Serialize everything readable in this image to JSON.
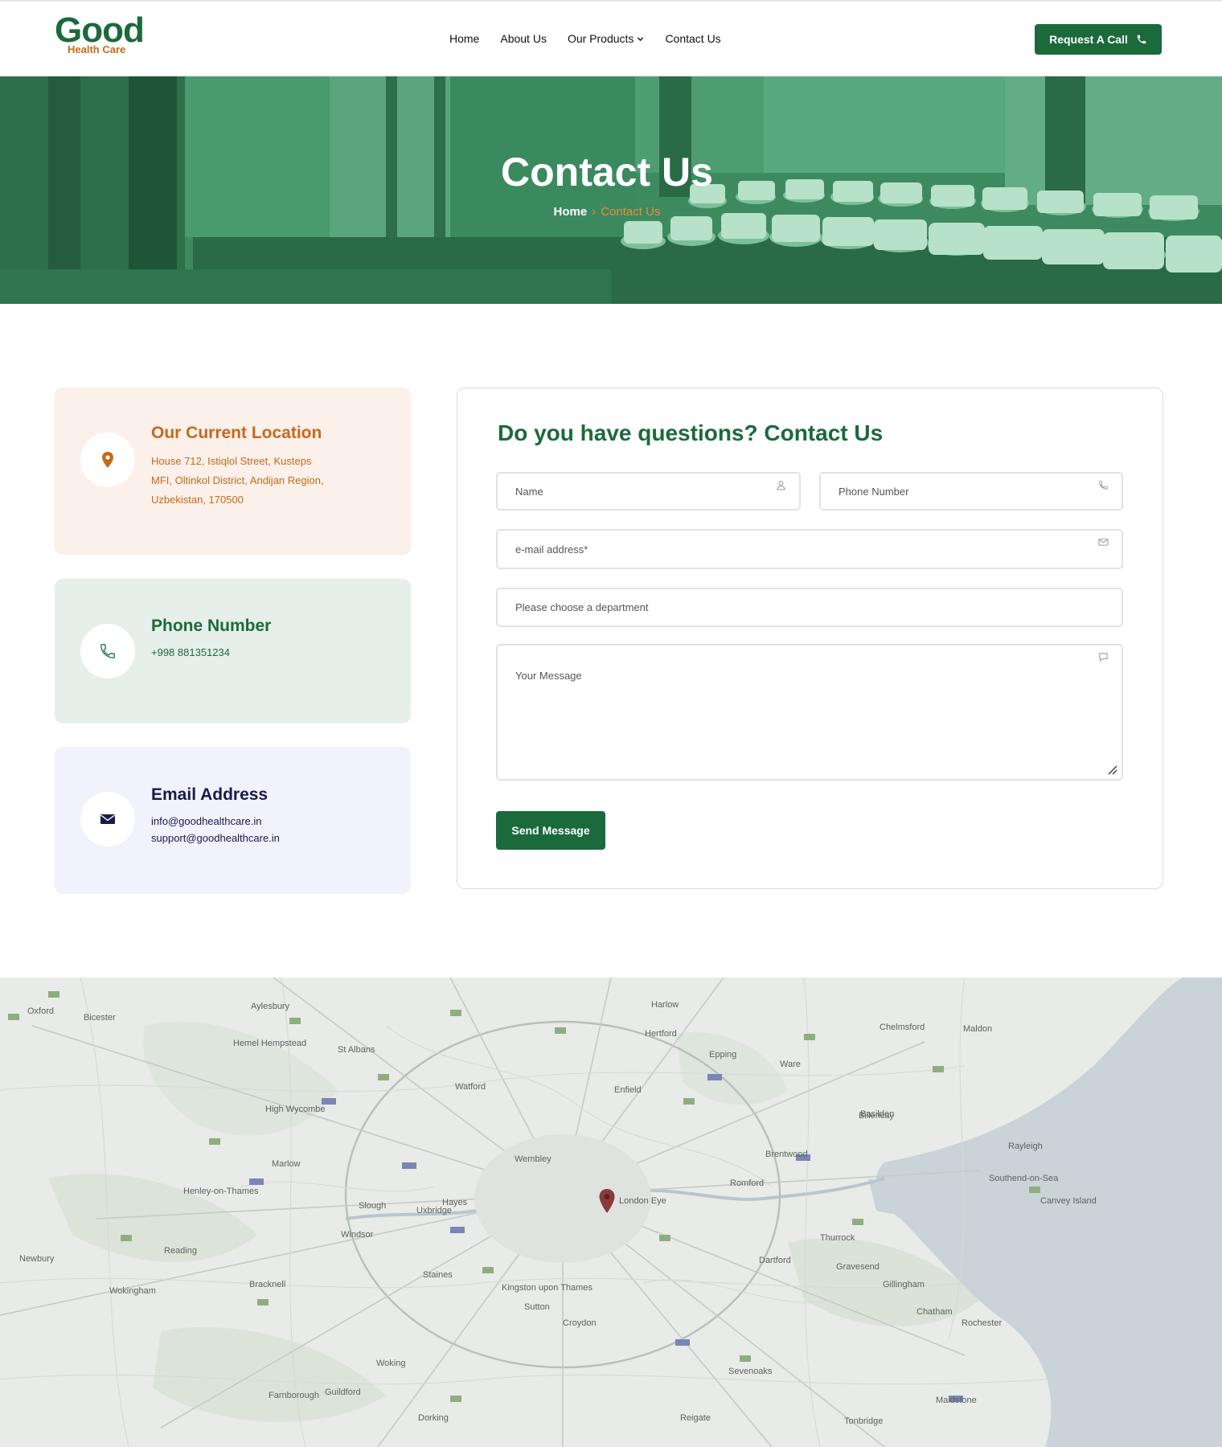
{
  "header": {
    "logo": {
      "main": "Good",
      "sub": "Health Care",
      "tagline": ""
    },
    "nav": [
      {
        "label": "Home"
      },
      {
        "label": "About Us"
      },
      {
        "label": "Our Products",
        "has_dropdown": true
      },
      {
        "label": "Contact Us"
      }
    ],
    "cta_label": "Request A Call"
  },
  "hero": {
    "title": "Contact Us",
    "breadcrumb": {
      "home": "Home",
      "separator": "›",
      "current": "Contact Us"
    }
  },
  "cards": {
    "location": {
      "title": "Our Current Location",
      "lines": [
        "House 712, Istiqlol Street, Kusteps",
        "MFI, Oltinkol District, Andijan Region,",
        "Uzbekistan, 170500"
      ],
      "icon": "location-pin-icon"
    },
    "phone": {
      "title": "Phone Number",
      "lines": [
        "+998 881351234"
      ],
      "icon": "phone-icon"
    },
    "email": {
      "title": "Email Address",
      "lines": [
        "info@goodhealthcare.in",
        "support@goodhealthcare.in"
      ],
      "icon": "envelope-icon"
    }
  },
  "form": {
    "title": "Do you have questions? Contact Us",
    "name_placeholder": "Name",
    "phone_placeholder": "Phone Number",
    "email_placeholder": "e-mail address*",
    "department_placeholder": "Please choose a department",
    "message_placeholder": "Your Message",
    "submit_label": "Send Message"
  },
  "map": {
    "pin_label": "London Eye",
    "places": [
      "Oxford",
      "Bicester",
      "Aylesbury",
      "Hemel Hempstead",
      "St Albans",
      "Harlow",
      "Chelmsford",
      "Maldon",
      "High Wycombe",
      "Watford",
      "Enfield",
      "Epping",
      "Brentwood",
      "Basildon",
      "Southend-on-Sea",
      "Reading",
      "Slough",
      "Hayes",
      "Wembley",
      "Romford",
      "Dartford",
      "Gravesend",
      "Chatham",
      "Bracknell",
      "Woking",
      "Guildford",
      "Sevenoaks",
      "Maidstone",
      "Croydon",
      "Kingston upon Thames",
      "Sutton",
      "Gillingham",
      "Rochester",
      "Thurrock",
      "Wokingham",
      "Henley-on-Thames",
      "Marlow",
      "Newbury",
      "Farnborough",
      "Dorking",
      "Reigate",
      "Tonbridge",
      "Canvey Island",
      "Rayleigh",
      "Billericay",
      "Ware",
      "Hertford",
      "Windsor",
      "Staines",
      "Uxbridge"
    ]
  },
  "colors": {
    "brand_green": "#1b6a3b",
    "accent_orange": "#c66a19",
    "navy": "#1a1a4a"
  }
}
